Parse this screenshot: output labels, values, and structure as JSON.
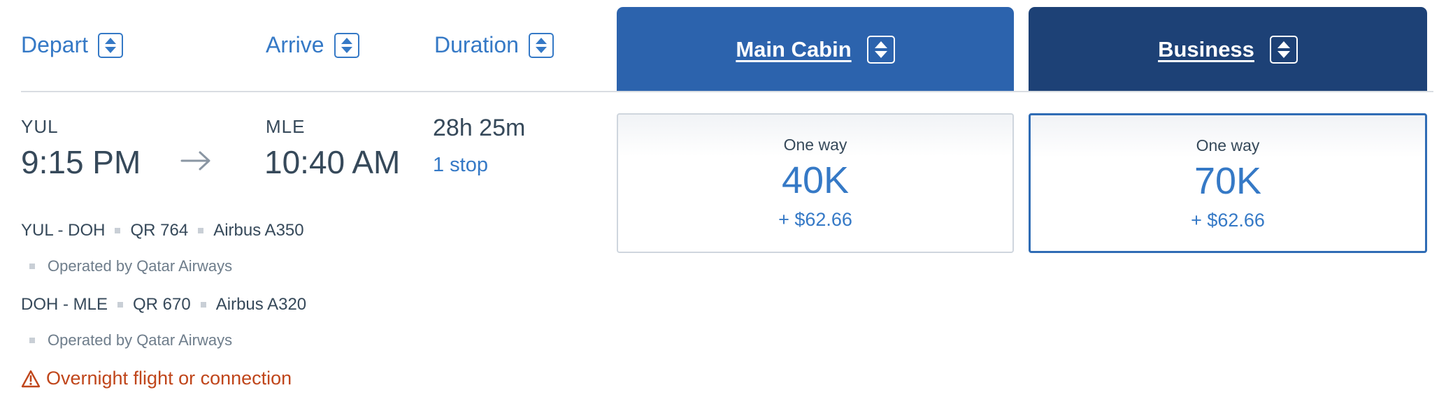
{
  "header": {
    "depart_label": "Depart",
    "arrive_label": "Arrive",
    "duration_label": "Duration"
  },
  "cabins": [
    {
      "label": "Main Cabin",
      "color": "#2c63ad"
    },
    {
      "label": "Business",
      "color": "#1d4176"
    }
  ],
  "flight": {
    "origin_code": "YUL",
    "depart_time": "9:15 PM",
    "dest_code": "MLE",
    "arrive_time": "10:40 AM",
    "duration": "28h 25m",
    "stops": "1 stop",
    "segments": [
      {
        "route": "YUL - DOH",
        "flight_no": "QR 764",
        "aircraft": "Airbus A350",
        "operated_by": "Operated by Qatar Airways"
      },
      {
        "route": "DOH - MLE",
        "flight_no": "QR 670",
        "aircraft": "Airbus A320",
        "operated_by": "Operated by Qatar Airways"
      }
    ],
    "warning": "Overnight flight or connection"
  },
  "prices": [
    {
      "label": "One way",
      "miles": "40K",
      "tax": "+ $62.66"
    },
    {
      "label": "One way",
      "miles": "70K",
      "tax": "+ $62.66"
    }
  ],
  "colors": {
    "link_blue": "#3579c6",
    "warning_orange": "#c0461b"
  },
  "icons": {
    "sort": "sort-updown-icon",
    "arrow": "arrow-right-icon",
    "warning": "warning-triangle-icon"
  }
}
